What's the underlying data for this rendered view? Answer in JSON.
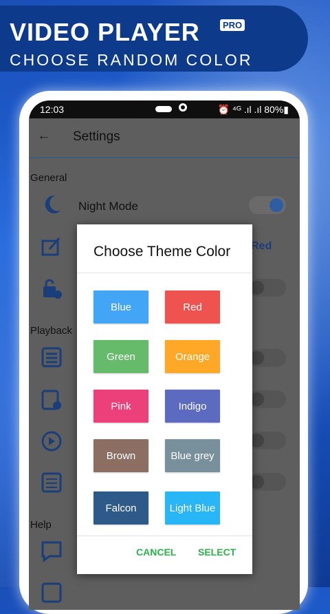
{
  "promo": {
    "title": "VIDEO PLAYER",
    "badge": "PRO",
    "subtitle": "CHOOSE RANDOM COLOR"
  },
  "status": {
    "time": "12:03",
    "indicators": "⏰ ⁴ᴳ .ıl .ıl 80%▮"
  },
  "appbar": {
    "title": "Settings"
  },
  "sections": {
    "general": "General",
    "playback": "Playback",
    "help": "Help"
  },
  "rows": {
    "night_mode": "Night Mode",
    "theme_value": "Red"
  },
  "dialog": {
    "title": "Choose Theme Color",
    "colors": [
      {
        "label": "Blue",
        "color": "#42a5f5"
      },
      {
        "label": "Red",
        "color": "#ef5350"
      },
      {
        "label": "Green",
        "color": "#66bb6a"
      },
      {
        "label": "Orange",
        "color": "#ffa726"
      },
      {
        "label": "Pink",
        "color": "#ec407a"
      },
      {
        "label": "Indigo",
        "color": "#5c6bc0"
      },
      {
        "label": "Brown",
        "color": "#8d6e63"
      },
      {
        "label": "Blue grey",
        "color": "#78909c"
      },
      {
        "label": "Falcon",
        "color": "#2e5a8a"
      },
      {
        "label": "Light Blue",
        "color": "#29b6f6"
      }
    ],
    "cancel": "CANCEL",
    "select": "SELECT"
  }
}
